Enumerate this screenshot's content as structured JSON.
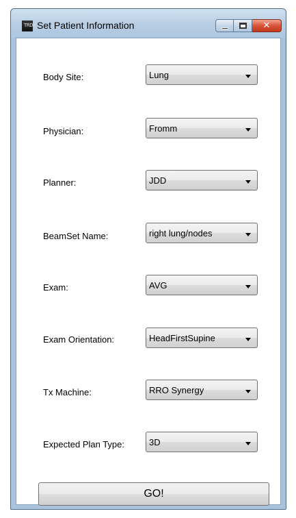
{
  "window": {
    "title": "Set Patient Information",
    "icon_text": "TRDV"
  },
  "controls": {
    "minimize": "minimize",
    "maximize": "maximize",
    "close": "✕"
  },
  "fields": [
    {
      "label": "Body Site:",
      "value": "Lung"
    },
    {
      "label": "Physician:",
      "value": "Fromm"
    },
    {
      "label": "Planner:",
      "value": "JDD"
    },
    {
      "label": "BeamSet Name:",
      "value": "right lung/nodes"
    },
    {
      "label": "Exam:",
      "value": "AVG"
    },
    {
      "label": "Exam Orientation:",
      "value": "HeadFirstSupine"
    },
    {
      "label": "Tx Machine:",
      "value": "RRO Synergy"
    },
    {
      "label": "Expected Plan Type:",
      "value": "3D"
    }
  ],
  "go_button": {
    "label": "GO!"
  }
}
